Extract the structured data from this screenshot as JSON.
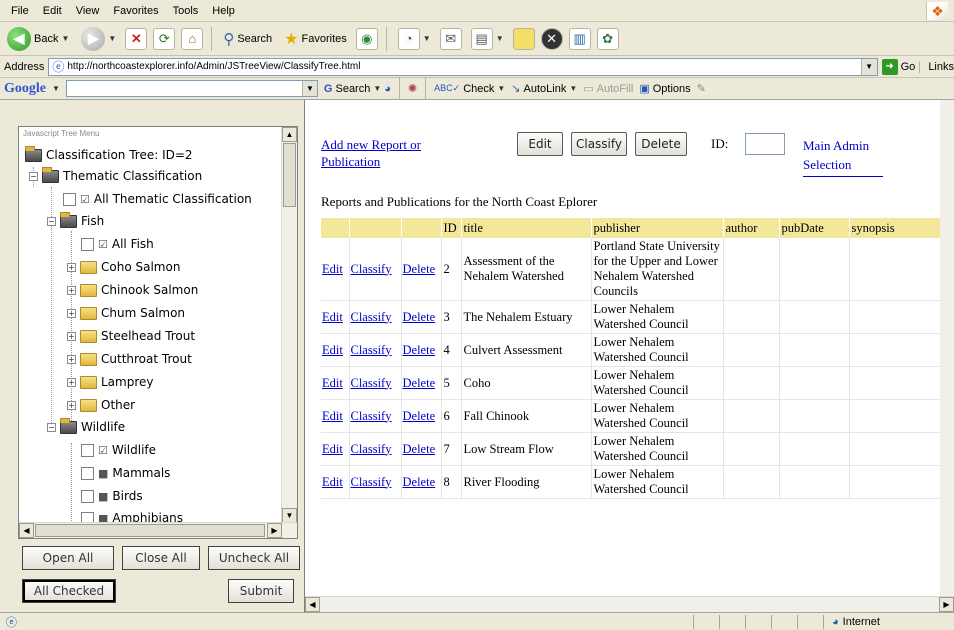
{
  "menu": [
    "File",
    "Edit",
    "View",
    "Favorites",
    "Tools",
    "Help"
  ],
  "toolbar": {
    "back_label": "Back",
    "search_label": "Search",
    "favorites_label": "Favorites"
  },
  "address": {
    "label": "Address",
    "url": "http://northcoastexplorer.info/Admin/JSTreeView/ClassifyTree.html",
    "go_label": "Go",
    "links_label": "Links"
  },
  "google_bar": {
    "logo": "Google",
    "search_label": "Search",
    "check_label": "Check",
    "autolink_label": "AutoLink",
    "autofill_label": "AutoFill",
    "options_label": "Options"
  },
  "tree": {
    "menu_title": "Javascript Tree Menu",
    "root": "Classification Tree: ID=2",
    "nodes": {
      "thematic": "Thematic Classification",
      "all_thematic": "All Thematic Classification",
      "fish": "Fish",
      "all_fish": "All Fish",
      "coho": "Coho Salmon",
      "chinook": "Chinook Salmon",
      "chum": "Chum Salmon",
      "steelhead": "Steelhead Trout",
      "cutthroat": "Cutthroat Trout",
      "lamprey": "Lamprey",
      "other": "Other",
      "wildlife": "Wildlife",
      "wildlife_item": "Wildlife",
      "mammals": "Mammals",
      "birds": "Birds",
      "amphibians": "Amphibians"
    },
    "buttons": {
      "open_all": "Open All",
      "close_all": "Close All",
      "uncheck_all": "Uncheck All",
      "all_checked": "All Checked",
      "submit": "Submit"
    }
  },
  "main": {
    "add_link": "Add new Report or Publication",
    "edit_btn": "Edit",
    "classify_btn": "Classify",
    "delete_btn": "Delete",
    "id_label": "ID:",
    "admin_link": "Main Admin Selection",
    "heading": "Reports and Publications for the North Coast Eplorer",
    "columns": [
      "",
      "",
      "",
      "ID",
      "title",
      "publisher",
      "author",
      "pubDate",
      "synopsis"
    ],
    "action_labels": {
      "edit": "Edit",
      "classify": "Classify",
      "delete": "Delete"
    },
    "rows": [
      {
        "id": "2",
        "title": "Assessment of the Nehalem Watershed",
        "publisher": "Portland State University for the Upper and Lower Nehalem Watershed Councils",
        "author": "",
        "pubDate": "",
        "synopsis": ""
      },
      {
        "id": "3",
        "title": "The Nehalem Estuary",
        "publisher": "Lower Nehalem Watershed Council",
        "author": "",
        "pubDate": "",
        "synopsis": ""
      },
      {
        "id": "4",
        "title": "Culvert Assessment",
        "publisher": "Lower Nehalem Watershed Council",
        "author": "",
        "pubDate": "",
        "synopsis": ""
      },
      {
        "id": "5",
        "title": "Coho",
        "publisher": "Lower Nehalem Watershed Council",
        "author": "",
        "pubDate": "",
        "synopsis": ""
      },
      {
        "id": "6",
        "title": "Fall Chinook",
        "publisher": "Lower Nehalem Watershed Council",
        "author": "",
        "pubDate": "",
        "synopsis": ""
      },
      {
        "id": "7",
        "title": "Low Stream Flow",
        "publisher": "Lower Nehalem Watershed Council",
        "author": "",
        "pubDate": "",
        "synopsis": ""
      },
      {
        "id": "8",
        "title": "River Flooding",
        "publisher": "Lower Nehalem Watershed Council",
        "author": "",
        "pubDate": "",
        "synopsis": ""
      }
    ]
  },
  "status": {
    "zone": "Internet"
  }
}
